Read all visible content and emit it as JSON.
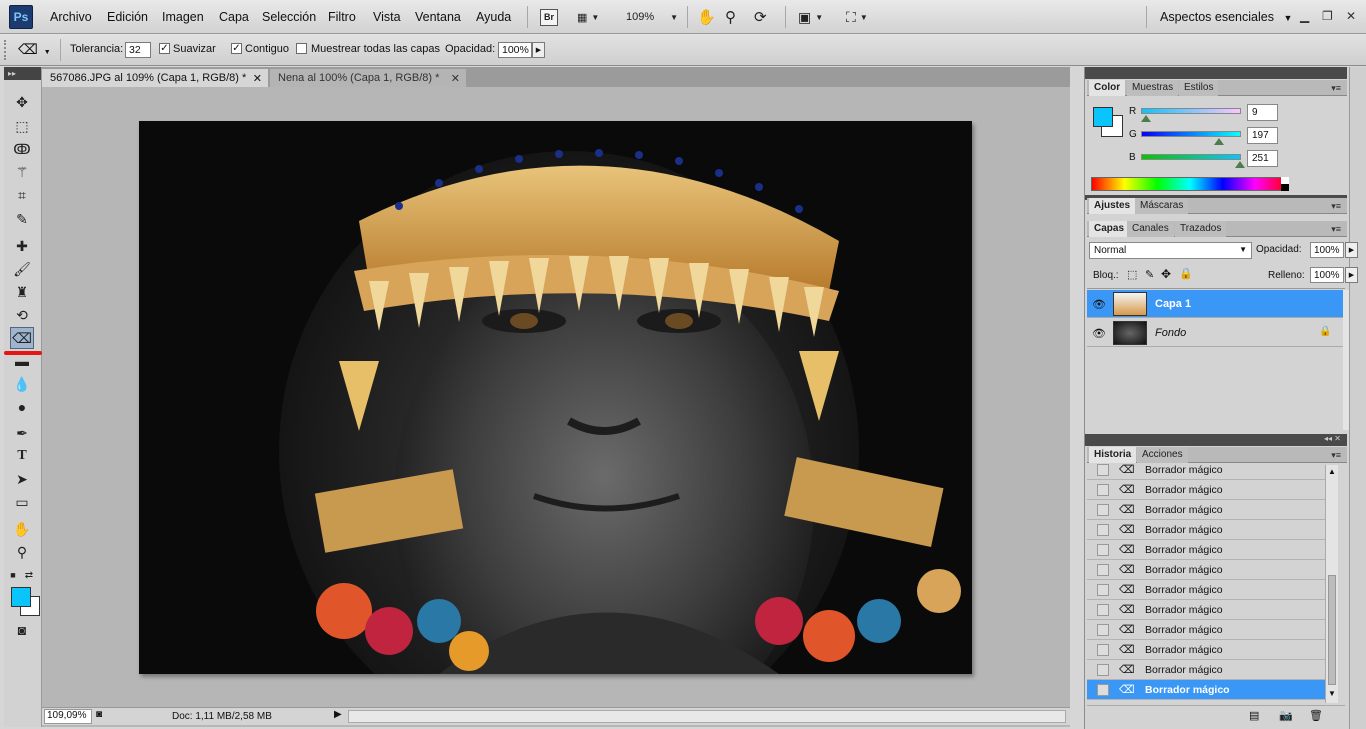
{
  "menu": {
    "logo": "Ps",
    "items": [
      "Archivo",
      "Edición",
      "Imagen",
      "Capa",
      "Selección",
      "Filtro",
      "Vista",
      "Ventana",
      "Ayuda"
    ],
    "bridge_label": "Br",
    "zoom_value": "109%",
    "workspace_label": "Aspectos esenciales"
  },
  "options": {
    "tolerance_label": "Tolerancia:",
    "tolerance_value": "32",
    "antialias_label": "Suavizar",
    "contiguous_label": "Contiguo",
    "sample_all_label": "Muestrear todas las capas",
    "opacity_label": "Opacidad:",
    "opacity_value": "100%"
  },
  "documents": {
    "tabs": [
      {
        "label": "567086.JPG al 109% (Capa 1, RGB/8) *"
      },
      {
        "label": "Nena al 100% (Capa 1, RGB/8) *"
      }
    ]
  },
  "status": {
    "zoom": "109,09%",
    "doc_info": "Doc: 1,11 MB/2,58 MB"
  },
  "color_panel": {
    "tabs": [
      "Color",
      "Muestras",
      "Estilos"
    ],
    "r_label": "R",
    "r_value": "9",
    "g_label": "G",
    "g_value": "197",
    "b_label": "B",
    "b_value": "251",
    "foreground": "#09c5fb",
    "background": "#ffffff"
  },
  "adjust_panel": {
    "tabs": [
      "Ajustes",
      "Máscaras"
    ]
  },
  "layers_panel": {
    "tabs": [
      "Capas",
      "Canales",
      "Trazados"
    ],
    "blend_mode": "Normal",
    "opacity_label": "Opacidad:",
    "opacity_value": "100%",
    "lock_label": "Bloq.:",
    "fill_label": "Relleno:",
    "fill_value": "100%",
    "layers": [
      {
        "name": "Capa 1",
        "selected": true
      },
      {
        "name": "Fondo",
        "selected": false
      }
    ]
  },
  "history_panel": {
    "tabs": [
      "Historia",
      "Acciones"
    ],
    "items": [
      "Borrador mágico",
      "Borrador mágico",
      "Borrador mágico",
      "Borrador mágico",
      "Borrador mágico",
      "Borrador mágico",
      "Borrador mágico",
      "Borrador mágico",
      "Borrador mágico",
      "Borrador mágico",
      "Borrador mágico",
      "Borrador mágico"
    ]
  },
  "colors": {
    "accent": "#3a97f5",
    "annotation_mark": "#e51515"
  }
}
